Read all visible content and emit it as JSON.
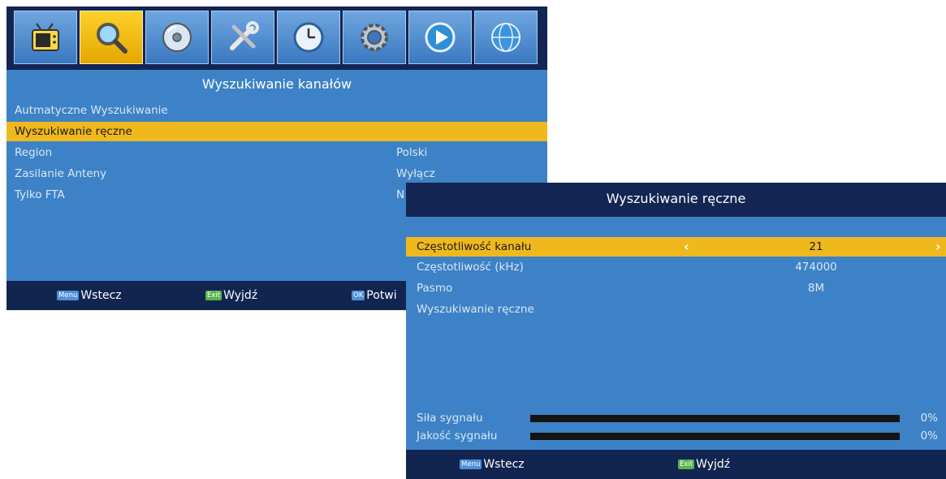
{
  "main_menu": {
    "tabs": [
      {
        "icon": "tv-icon",
        "active": false
      },
      {
        "icon": "search-icon",
        "active": true
      },
      {
        "icon": "disc-icon",
        "active": false
      },
      {
        "icon": "tools-icon",
        "active": false
      },
      {
        "icon": "clock-icon",
        "active": false
      },
      {
        "icon": "gear-icon",
        "active": false
      },
      {
        "icon": "play-icon",
        "active": false
      },
      {
        "icon": "globe-icon",
        "active": false
      }
    ],
    "title": "Wyszukiwanie kanałów",
    "items": [
      {
        "label": "Autmatyczne Wyszukiwanie",
        "value": ""
      },
      {
        "label": "Wyszukiwanie ręczne",
        "value": "",
        "selected": true
      },
      {
        "label": "Region",
        "value": "Polski"
      },
      {
        "label": "Zasilanie Anteny",
        "value": "Wyłącz"
      },
      {
        "label": "Tylko FTA",
        "value": "N"
      }
    ],
    "footer": {
      "back_key": "Menu",
      "back_label": "Wstecz",
      "exit_key": "Exit",
      "exit_label": "Wyjdź",
      "ok_key": "OK",
      "ok_label": "Potwi"
    }
  },
  "manual_search": {
    "title": "Wyszukiwanie ręczne",
    "items": [
      {
        "label": "Częstotliwość kanału",
        "value": "21",
        "selected": true
      },
      {
        "label": "Częstotliwość (kHz)",
        "value": "474000"
      },
      {
        "label": "Pasmo",
        "value": "8M"
      },
      {
        "label": "Wyszukiwanie ręczne",
        "value": ""
      }
    ],
    "signal_strength": {
      "label": "Siła sygnału",
      "percent_text": "0%",
      "level": 0
    },
    "signal_quality": {
      "label": "Jakość sygnału",
      "percent_text": "0%",
      "level": 0
    },
    "footer": {
      "back_key": "Menu",
      "back_label": "Wstecz",
      "exit_key": "Exit",
      "exit_label": "Wyjdź"
    }
  },
  "colors": {
    "panel_bg": "#3d82c6",
    "bar_bg": "#132552",
    "highlight": "#efb81d",
    "signal_bar": "#141414"
  }
}
